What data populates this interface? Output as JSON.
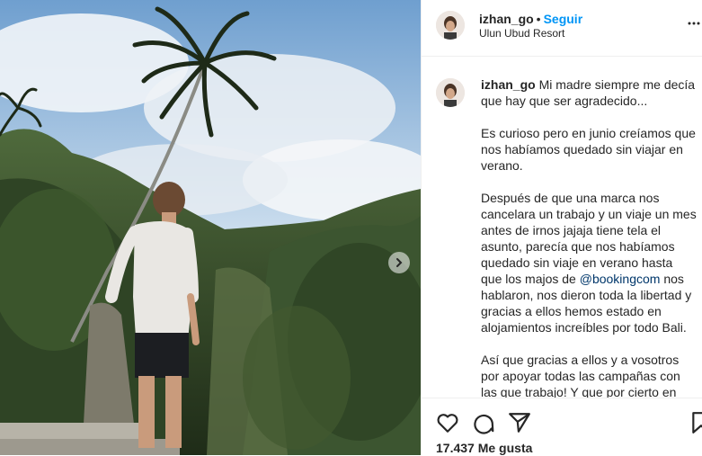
{
  "post": {
    "username": "izhan_go",
    "separator": "•",
    "follow_label": "Seguir",
    "location": "Ulun Ubud Resort",
    "more_icon": "more-options-icon",
    "caption_user": "izhan_go",
    "caption_paragraphs": [
      "Mi madre siempre me decía que hay que ser agradecido...",
      "Es curioso pero en junio creíamos que nos habíamos quedado sin viajar en verano.",
      "quedado sin viaje en verano hasta que los majos de",
      "nos hablaron, nos dieron toda la libertad y gracias a ellos hemos estado en alojamientos increíbles por todo Bali.",
      "Así que gracias a ellos y a vosotros por apoyar todas las campañas con las que trabajo! Y que por cierto en"
    ],
    "caption_p3_start": "Después de que una marca nos cancelara un trabajo y un viaje un mes antes de irnos jajaja tiene tela el asunto, parecía que nos habíamos",
    "mention": "@bookingcom",
    "likes": "17.437 Me gusta"
  },
  "icons": {
    "like": "heart-icon",
    "comment": "comment-icon",
    "share": "share-icon",
    "save": "bookmark-icon",
    "next": "chevron-right-icon"
  },
  "colors": {
    "follow": "#0095f6",
    "text": "#262626",
    "border": "#efefef"
  }
}
